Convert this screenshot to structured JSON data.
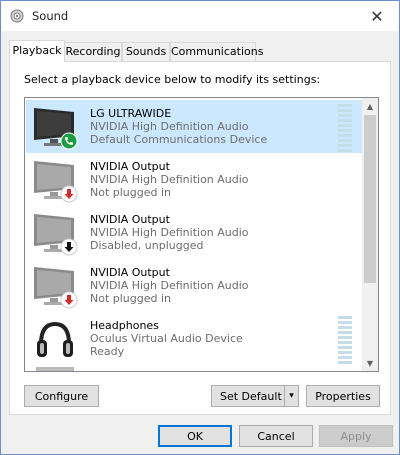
{
  "window": {
    "title": "Sound",
    "close_glyph": "✕"
  },
  "tabs": [
    {
      "label": "Playback",
      "active": true
    },
    {
      "label": "Recording",
      "active": false
    },
    {
      "label": "Sounds",
      "active": false
    },
    {
      "label": "Communications",
      "active": false
    }
  ],
  "instruction": "Select a playback device below to modify its settings:",
  "devices": [
    {
      "name": "LG ULTRAWIDE",
      "driver": "NVIDIA High Definition Audio",
      "status": "Default Communications Device",
      "icon": "monitor-icon",
      "badge": "phone-badge",
      "selected": true,
      "meter": true
    },
    {
      "name": "NVIDIA Output",
      "driver": "NVIDIA High Definition Audio",
      "status": "Not plugged in",
      "icon": "monitor-icon",
      "badge": "red-down-arrow-badge",
      "selected": false,
      "meter": false
    },
    {
      "name": "NVIDIA Output",
      "driver": "NVIDIA High Definition Audio",
      "status": "Disabled, unplugged",
      "icon": "monitor-icon",
      "badge": "black-down-arrow-badge",
      "selected": false,
      "meter": false
    },
    {
      "name": "NVIDIA Output",
      "driver": "NVIDIA High Definition Audio",
      "status": "Not plugged in",
      "icon": "monitor-icon",
      "badge": "red-down-arrow-badge",
      "selected": false,
      "meter": false
    },
    {
      "name": "Headphones",
      "driver": "Oculus Virtual Audio Device",
      "status": "Ready",
      "icon": "headphones-icon",
      "badge": "",
      "selected": false,
      "meter": true
    }
  ],
  "buttons": {
    "configure": "Configure",
    "set_default": "Set Default",
    "set_default_arrow": "▾",
    "properties": "Properties",
    "ok": "OK",
    "cancel": "Cancel",
    "apply": "Apply"
  },
  "colors": {
    "selection": "#cce8ff",
    "accent": "#0078d7",
    "badge_green": "#1a9e3f",
    "badge_red": "#d42b2b"
  }
}
